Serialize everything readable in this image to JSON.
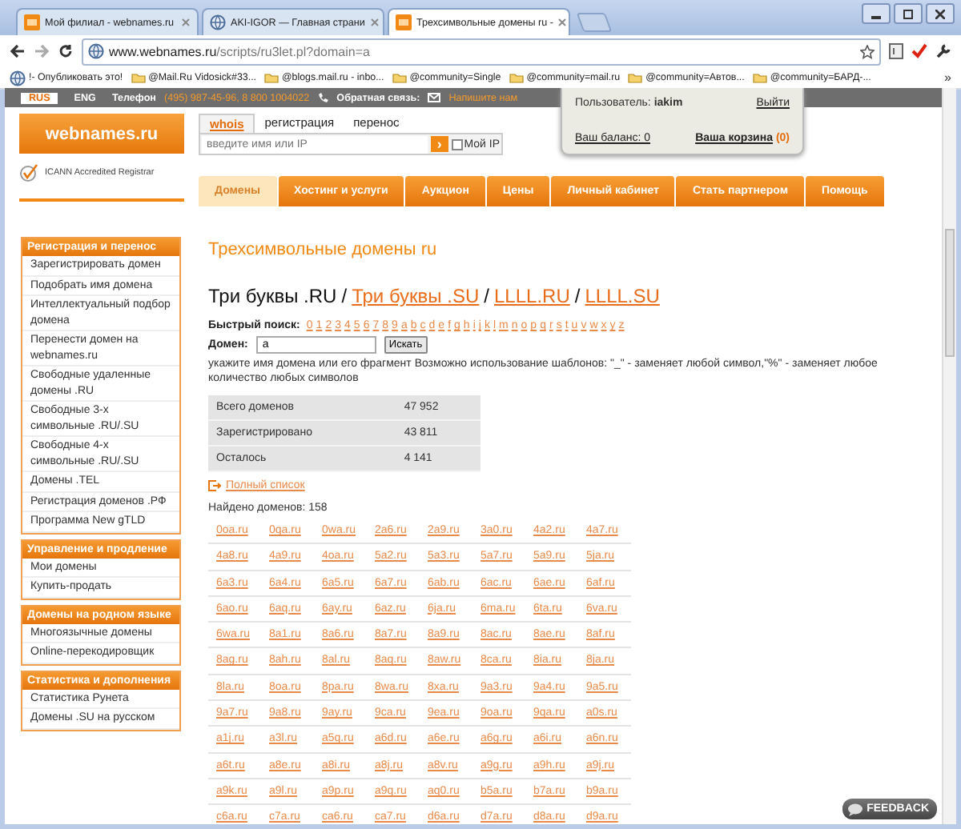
{
  "browser": {
    "tabs": [
      {
        "title": "Мой филиал - webnames.ru",
        "kind": "site",
        "selected": false
      },
      {
        "title": "AKI-IGOR — Главная страни",
        "kind": "globe",
        "selected": false
      },
      {
        "title": "Трехсимвольные домены ru -",
        "kind": "site",
        "selected": true
      }
    ],
    "address": {
      "host": "www.webnames.ru",
      "path": "/scripts/ru3let.pl?domain=a"
    },
    "bookmarks": [
      {
        "label": "!- Опубликовать это!",
        "kind": "page"
      },
      {
        "label": "@Mail.Ru Vidosick#33...",
        "kind": "folder"
      },
      {
        "label": "@blogs.mail.ru - inbo...",
        "kind": "folder"
      },
      {
        "label": "@community=Single",
        "kind": "folder"
      },
      {
        "label": "@community=mail.ru",
        "kind": "folder"
      },
      {
        "label": "@community=Автов...",
        "kind": "folder"
      },
      {
        "label": "@community=БАРД-...",
        "kind": "folder"
      }
    ],
    "more": "»"
  },
  "site": {
    "langs": [
      {
        "label": "RUS",
        "selected": true
      },
      {
        "label": "ENG",
        "selected": false
      }
    ],
    "phone_label": "Телефон",
    "phones": "(495) 987-45-96, 8 800 1004022",
    "feedback_label": "Обратная связь:",
    "feedback_link": "Напишите нам",
    "user": {
      "label": "Пользователь:",
      "name": "iakim",
      "logout": "Выйти",
      "balance": "Ваш баланс: 0",
      "cart": "Ваша корзина",
      "cart_count": "(0)"
    },
    "logo": "webnames.ru",
    "icann": "ICANN Accredited Registrar",
    "search_tabs": [
      {
        "label": "whois",
        "selected": true
      },
      {
        "label": "регистрация",
        "selected": false
      },
      {
        "label": "перенос",
        "selected": false
      }
    ],
    "search_placeholder": "введите имя или IP",
    "go": "›",
    "my_ip": {
      "label": "Мой IP",
      "checked": false
    },
    "nav": [
      {
        "label": "Домены",
        "selected": true
      },
      {
        "label": "Хостинг и услуги",
        "selected": false
      },
      {
        "label": "Аукцион",
        "selected": false
      },
      {
        "label": "Цены",
        "selected": false
      },
      {
        "label": "Личный кабинет",
        "selected": false
      },
      {
        "label": "Стать партнером",
        "selected": false
      },
      {
        "label": "Помощь",
        "selected": false
      }
    ]
  },
  "sidebar": [
    {
      "title": "Регистрация и перенос",
      "items": [
        "Зарегистрировать домен",
        "Подобрать имя домена",
        "Интеллектуальный подбор домена",
        "Перенести домен на webnames.ru",
        "Свободные удаленные домены .RU",
        "Свободные 3-х символьные .RU/.SU",
        "Свободные 4-х символьные .RU/.SU",
        "Домены .TEL",
        "Регистрация доменов .РФ",
        "Программа New gTLD"
      ]
    },
    {
      "title": "Управление и продление",
      "items": [
        "Мои домены",
        "Купить-продать"
      ]
    },
    {
      "title": "Домены на родном языке",
      "items": [
        "Многоязычные домены",
        "Online-перекодировщик"
      ]
    },
    {
      "title": "Статистика и дополнения",
      "items": [
        "Статистика Рунета",
        "Домены .SU на русском"
      ]
    }
  ],
  "main": {
    "title": "Трехсимвольные домены ru",
    "tld_links": [
      {
        "label": "Три буквы .RU",
        "kind": "current"
      },
      {
        "label": "/",
        "kind": "separator"
      },
      {
        "label": "Три буквы .SU",
        "kind": "link"
      },
      {
        "label": "/",
        "kind": "separator"
      },
      {
        "label": "LLLL.RU",
        "kind": "link"
      },
      {
        "label": "/",
        "kind": "separator"
      },
      {
        "label": "LLLL.SU",
        "kind": "link"
      }
    ],
    "quick_label": "Быстрый поиск:",
    "quick_chars": [
      "0",
      "1",
      "2",
      "3",
      "4",
      "5",
      "6",
      "7",
      "8",
      "9",
      "a",
      "b",
      "c",
      "d",
      "e",
      "f",
      "g",
      "h",
      "i",
      "j",
      "k",
      "l",
      "m",
      "n",
      "o",
      "p",
      "q",
      "r",
      "s",
      "t",
      "u",
      "v",
      "w",
      "x",
      "y",
      "z"
    ],
    "domain_label": "Домен:",
    "domain_value": "a",
    "search_button": "Искать",
    "hint": "укажите имя домена или его фрагмент Возможно использование шаблонов: \"_\" - заменяет любой символ,\"%\" - заменяет любое количество любых символов",
    "stats": [
      {
        "label": "Всего доменов",
        "value": "47 952"
      },
      {
        "label": "Зарегистрировано",
        "value": "43 811"
      },
      {
        "label": "Осталось",
        "value": "4 141"
      }
    ],
    "full_list": "Полный список",
    "found": "Найдено доменов: 158",
    "domains": [
      "0oa.ru",
      "0qa.ru",
      "0wa.ru",
      "2a6.ru",
      "2a9.ru",
      "3a0.ru",
      "4a2.ru",
      "4a7.ru",
      "4a8.ru",
      "4a9.ru",
      "4oa.ru",
      "5a2.ru",
      "5a3.ru",
      "5a7.ru",
      "5a9.ru",
      "5ja.ru",
      "6a3.ru",
      "6a4.ru",
      "6a5.ru",
      "6a7.ru",
      "6ab.ru",
      "6ac.ru",
      "6ae.ru",
      "6af.ru",
      "6ao.ru",
      "6aq.ru",
      "6ay.ru",
      "6az.ru",
      "6ja.ru",
      "6ma.ru",
      "6ta.ru",
      "6va.ru",
      "6wa.ru",
      "8a1.ru",
      "8a6.ru",
      "8a7.ru",
      "8a9.ru",
      "8ac.ru",
      "8ae.ru",
      "8af.ru",
      "8ag.ru",
      "8ah.ru",
      "8al.ru",
      "8aq.ru",
      "8aw.ru",
      "8ca.ru",
      "8ia.ru",
      "8ja.ru",
      "8la.ru",
      "8oa.ru",
      "8pa.ru",
      "8wa.ru",
      "8xa.ru",
      "9a3.ru",
      "9a4.ru",
      "9a5.ru",
      "9a7.ru",
      "9a8.ru",
      "9ay.ru",
      "9ca.ru",
      "9ea.ru",
      "9oa.ru",
      "9qa.ru",
      "a0s.ru",
      "a1j.ru",
      "a3l.ru",
      "a5q.ru",
      "a6d.ru",
      "a6e.ru",
      "a6g.ru",
      "a6i.ru",
      "a6n.ru",
      "a6t.ru",
      "a8e.ru",
      "a8i.ru",
      "a8j.ru",
      "a8v.ru",
      "a9g.ru",
      "a9h.ru",
      "a9j.ru",
      "a9k.ru",
      "a9l.ru",
      "a9p.ru",
      "a9q.ru",
      "aq0.ru",
      "b5a.ru",
      "b7a.ru",
      "b9a.ru",
      "c6a.ru",
      "c7a.ru",
      "ca6.ru",
      "ca7.ru",
      "d6a.ru",
      "d7a.ru",
      "d8a.ru",
      "d9a.ru"
    ]
  },
  "feedback": "FEEDBACK"
}
